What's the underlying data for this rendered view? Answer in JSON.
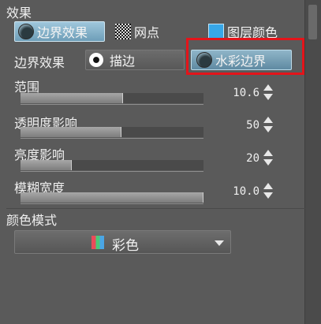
{
  "panel": {
    "section_title": "效果",
    "tabs": [
      {
        "label": "边界效果",
        "icon": "watercolor-circle-icon",
        "selected": true
      },
      {
        "label": "网点",
        "icon": "halftone-checker-icon",
        "selected": false
      },
      {
        "label": "图层颜色",
        "icon": "layer-color-icon",
        "selected": false
      }
    ],
    "edge_effect": {
      "label": "边界效果",
      "options": [
        {
          "label": "描边",
          "icon": "radio-icon",
          "selected": false
        },
        {
          "label": "水彩边界",
          "icon": "watercolor-circle-icon",
          "selected": true
        }
      ]
    },
    "sliders": [
      {
        "label": "范围",
        "value": "10.6",
        "fraction": 0.56
      },
      {
        "label": "透明度影响",
        "value": "50",
        "fraction": 0.55
      },
      {
        "label": "亮度影响",
        "value": "20",
        "fraction": 0.28
      },
      {
        "label": "模糊宽度",
        "value": "10.0",
        "fraction": 1.0
      }
    ],
    "color_mode": {
      "label": "颜色模式",
      "selected": "彩色",
      "icon": "rgb-swatch-icon"
    },
    "colors": {
      "accent": "#7fa9bf",
      "highlight_box": "#e4141a"
    }
  }
}
